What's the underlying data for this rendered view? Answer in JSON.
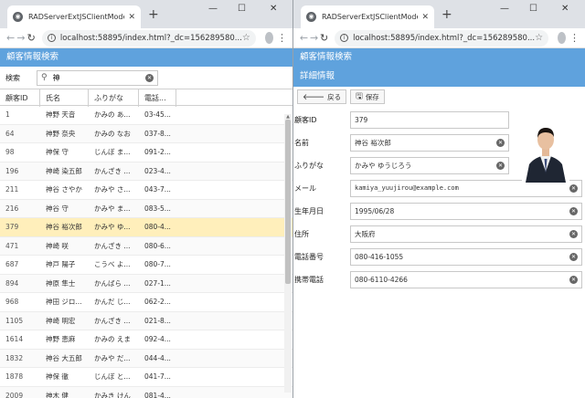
{
  "browser_left": {
    "tab_title": "RADServerExtJSClientModern",
    "url": "localhost:58895/index.html?_dc=156289580..."
  },
  "browser_right": {
    "tab_title": "RADServerExtJSClientModern",
    "url": "localhost:58895/index.html?_dc=156289580..."
  },
  "left": {
    "panel_title": "顧客情報検索",
    "search_label": "検索",
    "search_value": "神",
    "columns": [
      "顧客ID",
      "氏名",
      "ふりがな",
      "電話..."
    ],
    "rows": [
      [
        "1",
        "神野 天音",
        "かみの あ...",
        "03-45..."
      ],
      [
        "64",
        "神野 奈央",
        "かみの なお",
        "037-8..."
      ],
      [
        "98",
        "神保 守",
        "じんぼ ま...",
        "091-2..."
      ],
      [
        "196",
        "神崎 染五郎",
        "かんざき ...",
        "023-4..."
      ],
      [
        "211",
        "神谷 さやか",
        "かみや さ...",
        "043-7..."
      ],
      [
        "216",
        "神谷 守",
        "かみや ま...",
        "083-5..."
      ],
      [
        "379",
        "神谷 裕次郎",
        "かみや ゆ...",
        "080-4..."
      ],
      [
        "471",
        "神崎 咲",
        "かんざき ...",
        "080-6..."
      ],
      [
        "687",
        "神戸 陽子",
        "こうべ よ...",
        "080-7..."
      ],
      [
        "894",
        "神原 隼士",
        "かんばら ...",
        "027-1..."
      ],
      [
        "968",
        "神田 ジロ...",
        "かんだ じ...",
        "062-2..."
      ],
      [
        "1105",
        "神崎 明宏",
        "かんざき ...",
        "021-8..."
      ],
      [
        "1614",
        "神野 恵麻",
        "かみの えま",
        "092-4..."
      ],
      [
        "1832",
        "神谷 大五郎",
        "かみや だ...",
        "044-4..."
      ],
      [
        "1878",
        "神保 徹",
        "じんぼ と...",
        "041-7..."
      ],
      [
        "2009",
        "神木 健",
        "かみき けん",
        "081-4..."
      ]
    ],
    "selected_index": 6
  },
  "right": {
    "panel_title": "顧客情報検索",
    "detail_title": "詳細情報",
    "back_label": "戻る",
    "save_label": "保存",
    "fields": [
      {
        "label": "顧客ID",
        "value": "379"
      },
      {
        "label": "名前",
        "value": "神谷 裕次郎"
      },
      {
        "label": "ふりがな",
        "value": "かみや ゆうじろう"
      },
      {
        "label": "メール",
        "value": "kamiya_yuujirou@example.com"
      },
      {
        "label": "生年月日",
        "value": "1995/06/28"
      },
      {
        "label": "住所",
        "value": "大阪府"
      },
      {
        "label": "電話番号",
        "value": "080-416-1055"
      },
      {
        "label": "携帯電話",
        "value": "080-6110-4266"
      }
    ]
  }
}
